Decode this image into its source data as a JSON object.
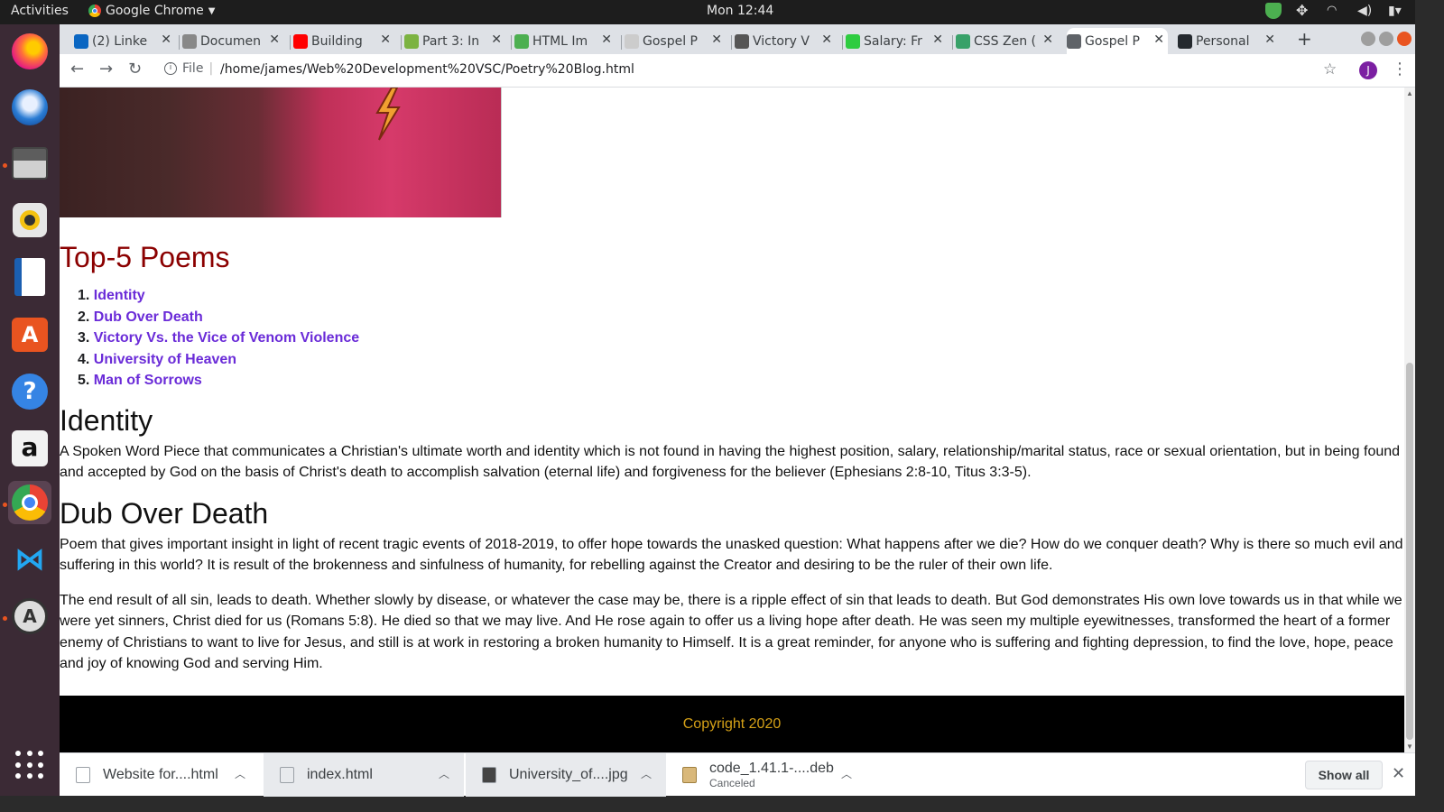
{
  "topbar": {
    "activities": "Activities",
    "app_name": "Google Chrome",
    "clock": "Mon 12:44"
  },
  "tabs": [
    {
      "title": "(2) Linke",
      "favicon_color": "#0a66c2",
      "icon": "linkedin-icon"
    },
    {
      "title": "Documen",
      "favicon_color": "#888888",
      "icon": "document-icon"
    },
    {
      "title": "Building",
      "favicon_color": "#ff0000",
      "icon": "youtube-icon"
    },
    {
      "title": "Part 3: In",
      "favicon_color": "#7cb342",
      "icon": "m-icon"
    },
    {
      "title": "HTML Im",
      "favicon_color": "#4caf50",
      "icon": "image-icon"
    },
    {
      "title": "Gospel P",
      "favicon_color": "#cccccc",
      "icon": "page-icon"
    },
    {
      "title": "Victory V",
      "favicon_color": "#555555",
      "icon": "thumbnail-icon"
    },
    {
      "title": "Salary: Fr",
      "favicon_color": "#2ecc40",
      "icon": "salary-icon"
    },
    {
      "title": "CSS Zen (",
      "favicon_color": "#38a169",
      "icon": "zen-icon"
    },
    {
      "title": "Gospel P",
      "favicon_color": "#5f6368",
      "icon": "globe-icon",
      "active": true
    },
    {
      "title": "Personal",
      "favicon_color": "#24292e",
      "icon": "github-icon"
    }
  ],
  "address": {
    "info_label": "File",
    "url": "/home/james/Web%20Development%20VSC/Poetry%20Blog.html",
    "avatar_letter": "J"
  },
  "page": {
    "top5_heading": "Top-5 Poems",
    "top5_list": [
      {
        "num": "1.",
        "title": "Identity"
      },
      {
        "num": "2.",
        "title": "Dub Over Death"
      },
      {
        "num": "3.",
        "title": "Victory Vs. the Vice of Venom Violence"
      },
      {
        "num": "4.",
        "title": "University of Heaven"
      },
      {
        "num": "5.",
        "title": "Man of Sorrows"
      }
    ],
    "identity_heading": "Identity",
    "identity_text": "A Spoken Word Piece that communicates a Christian's ultimate worth and identity which is not found in having the highest position, salary, relationship/marital status, race or sexual orientation, but in being found and accepted by God on the basis of Christ's death to accomplish salvation (eternal life) and forgiveness for the believer (Ephesians 2:8-10, Titus 3:3-5).",
    "dub_heading": "Dub Over Death",
    "dub_text_1": "Poem that gives important insight in light of recent tragic events of 2018-2019, to offer hope towards the unasked question: What happens after we die? How do we conquer death? Why is there so much evil and suffering in this world? It is result of the brokenness and sinfulness of humanity, for rebelling against the Creator and desiring to be the ruler of their own life.",
    "dub_text_2": "The end result of all sin, leads to death. Whether slowly by disease, or whatever the case may be, there is a ripple effect of sin that leads to death. But God demonstrates His own love towards us in that while we were yet sinners, Christ died for us (Romans 5:8). He died so that we may live. And He rose again to offer us a living hope after death. He was seen my multiple eyewitnesses, transformed the heart of a former enemy of Christians to want to live for Jesus, and still is at work in restoring a broken humanity to Himself. It is a great reminder, for anyone who is suffering and fighting depression, to find the love, hope, peace and joy of knowing God and serving Him.",
    "footer": "Copyright 2020"
  },
  "downloads": [
    {
      "name": "Website for....html",
      "status": ""
    },
    {
      "name": "index.html",
      "status": ""
    },
    {
      "name": "University_of....jpg",
      "status": ""
    },
    {
      "name": "code_1.41.1-....deb",
      "status": "Canceled"
    }
  ],
  "show_all_label": "Show all",
  "colors": {
    "heading_accent": "#8b0000",
    "link": "#6a2bd8",
    "footer_bg": "#000000",
    "footer_text": "#d4a017"
  }
}
